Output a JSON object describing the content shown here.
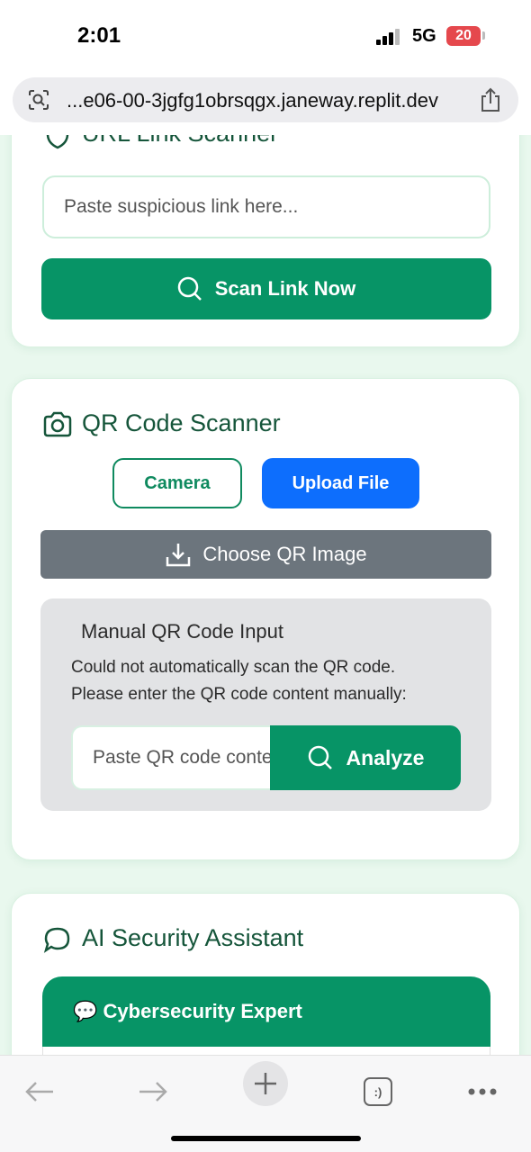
{
  "status_bar": {
    "time": "2:01",
    "network": "5G",
    "battery": "20"
  },
  "browser": {
    "url": "...e06-00-3jgfg1obrsqgx.janeway.replit.dev",
    "tab_count_icon": ":)"
  },
  "url_scanner": {
    "title": "URL Link Scanner",
    "input_placeholder": "Paste suspicious link here...",
    "scan_button": "Scan Link Now"
  },
  "qr_scanner": {
    "title": "QR Code Scanner",
    "tabs": [
      "Camera",
      "Upload File"
    ],
    "active_tab": "Upload File",
    "choose_button": "Choose QR Image",
    "manual": {
      "title": "Manual QR Code Input",
      "line1": "Could not automatically scan the QR code.",
      "line2": "Please enter the QR code content manually:",
      "input_placeholder": "Paste QR code content",
      "analyze_button": "Analyze"
    }
  },
  "assistant": {
    "title": "AI Security Assistant",
    "panel_title": "💬 Cybersecurity Expert"
  },
  "colors": {
    "primary": "#079466",
    "blue": "#0d6efd",
    "gray": "#6c757d",
    "background": "#e9f8ee"
  }
}
